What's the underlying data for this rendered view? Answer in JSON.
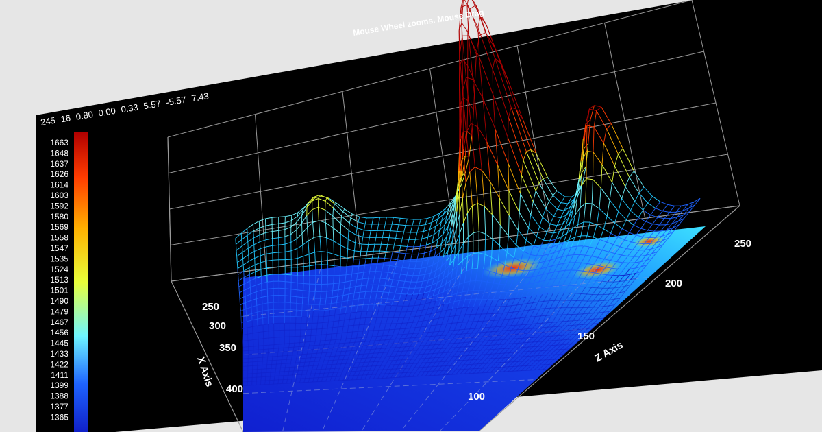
{
  "chart_title": "Mouse Wheel zooms. Mouse Drag",
  "coord_readout": [
    "245",
    "16",
    "0.80",
    "0.00",
    "0.33",
    "5.57",
    "-5.57",
    "7.43"
  ],
  "colors": {
    "page_background": "#e6e6e6",
    "chart_background": "#000000",
    "grid": "#9a9a9a",
    "text": "#ffffff",
    "gradient": [
      "#1020c8",
      "#1e63ff",
      "#22c8ff",
      "#6ef5ff",
      "#e8ff3a",
      "#ffb000",
      "#ff3c00",
      "#b00000"
    ]
  },
  "chart_data": {
    "type": "surface-3d",
    "axes": {
      "x": {
        "label": "X Axis",
        "ticks": [
          "250",
          "300",
          "350",
          "400"
        ]
      },
      "z": {
        "label": "Z Axis",
        "ticks": [
          "100",
          "150",
          "200",
          "250"
        ]
      },
      "y": {
        "label": "",
        "ticks": []
      }
    },
    "legend": {
      "position": "left",
      "labels": [
        "1663",
        "1648",
        "1637",
        "1626",
        "1614",
        "1603",
        "1592",
        "1580",
        "1569",
        "1558",
        "1547",
        "1535",
        "1524",
        "1513",
        "1501",
        "1490",
        "1479",
        "1467",
        "1456",
        "1445",
        "1433",
        "1422",
        "1411",
        "1399",
        "1388",
        "1377",
        "1365"
      ]
    },
    "grid": true,
    "projection": "wireframe-plus-contour-floor"
  }
}
